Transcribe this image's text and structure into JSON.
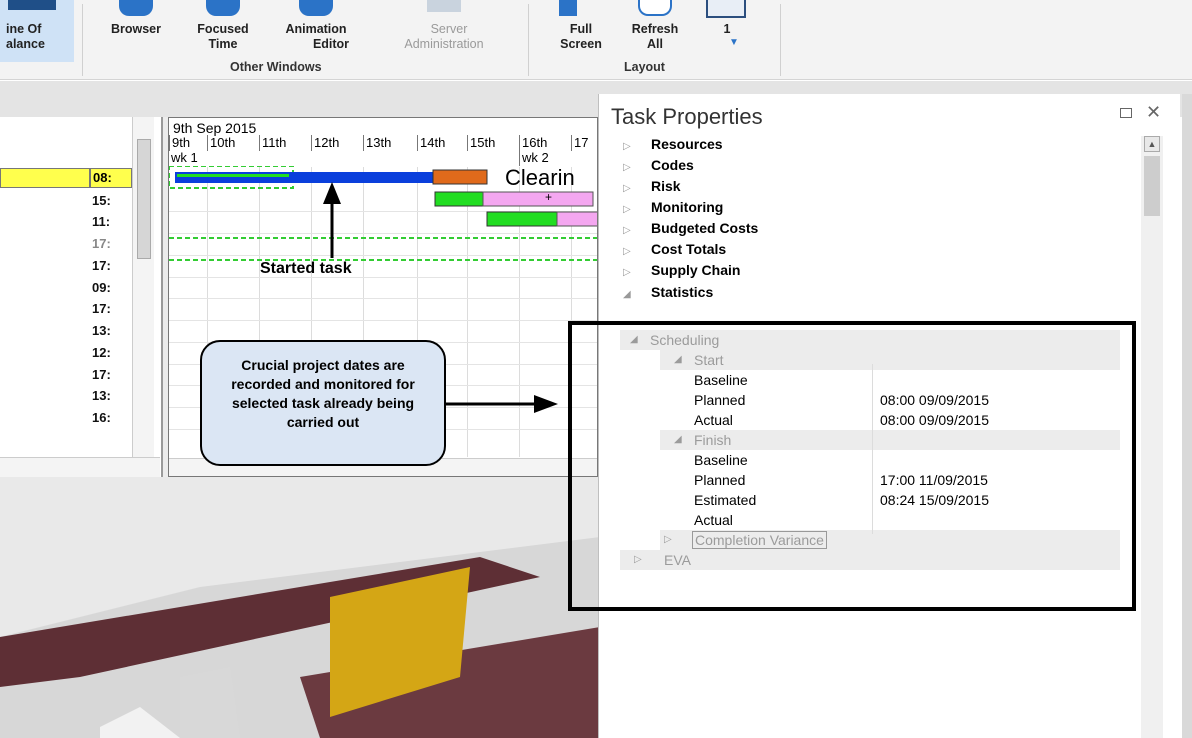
{
  "ribbon": {
    "cut_button": {
      "line1": "ine Of",
      "line2": "alance"
    },
    "buttons": [
      {
        "line1": "Browser",
        "line2": ""
      },
      {
        "line1": "Focused",
        "line2": "Time"
      },
      {
        "line1": "Animation",
        "line2": "Editor"
      },
      {
        "line1": "Server",
        "line2": "Administration"
      },
      {
        "line1": "Full",
        "line2": "Screen"
      },
      {
        "line1": "Refresh",
        "line2": "All"
      },
      {
        "line1": "1",
        "line2": ""
      }
    ],
    "groups": {
      "other_windows": "Other Windows",
      "layout": "Layout"
    }
  },
  "gantt": {
    "times": [
      "08:",
      "15:",
      "11:",
      "17:",
      "17:",
      "09:",
      "17:",
      "13:",
      "12:",
      "17:",
      "13:",
      "16:"
    ],
    "date_header": "9th Sep 2015",
    "days": [
      "9th",
      "10th",
      "11th",
      "12th",
      "13th",
      "14th",
      "15th",
      "16th",
      "17"
    ],
    "weeks": [
      "wk 1",
      "wk 2"
    ],
    "task_label": "Clearin",
    "bar_plus": "+"
  },
  "panel": {
    "title": "Task Properties",
    "sections": [
      "Resources",
      "Codes",
      "Risk",
      "Monitoring",
      "Budgeted Costs",
      "Cost Totals",
      "Supply Chain",
      "Statistics"
    ],
    "grid": {
      "scheduling": "Scheduling",
      "start": "Start",
      "start_rows": [
        {
          "key": "Baseline",
          "value": ""
        },
        {
          "key": "Planned",
          "value": "08:00 09/09/2015"
        },
        {
          "key": "Actual",
          "value": "08:00 09/09/2015"
        }
      ],
      "finish": "Finish",
      "finish_rows": [
        {
          "key": "Baseline",
          "value": ""
        },
        {
          "key": "Planned",
          "value": "17:00 11/09/2015"
        },
        {
          "key": "Estimated",
          "value": "08:24 15/09/2015"
        },
        {
          "key": "Actual",
          "value": ""
        }
      ],
      "completion_variance": "Completion Variance",
      "eva": "EVA"
    }
  },
  "annotations": {
    "started_task": "Started task",
    "callout": "Crucial project dates are recorded and monitored for selected task already being carried out"
  },
  "colors": {
    "bar_blue": "#0a3fdc",
    "bar_orange": "#e06a1b",
    "bar_green": "#22dd22",
    "bar_pink": "#f4a7f0",
    "highlight_yellow": "#ffff4d",
    "callout_fill": "#dbe6f4"
  }
}
